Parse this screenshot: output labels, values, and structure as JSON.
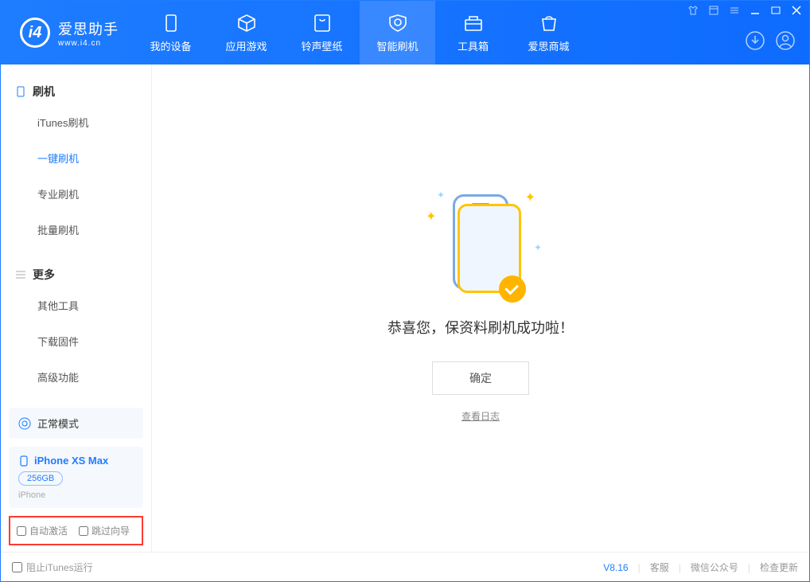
{
  "logo": {
    "main": "爱思助手",
    "sub": "www.i4.cn"
  },
  "nav": [
    {
      "label": "我的设备",
      "icon": "phone"
    },
    {
      "label": "应用游戏",
      "icon": "cube"
    },
    {
      "label": "铃声壁纸",
      "icon": "wallpaper"
    },
    {
      "label": "智能刷机",
      "icon": "shield",
      "active": true
    },
    {
      "label": "工具箱",
      "icon": "toolbox"
    },
    {
      "label": "爱思商城",
      "icon": "bag"
    }
  ],
  "sidebar": {
    "section1": {
      "title": "刷机",
      "items": [
        "iTunes刷机",
        "一键刷机",
        "专业刷机",
        "批量刷机"
      ],
      "activeIndex": 1
    },
    "section2": {
      "title": "更多",
      "items": [
        "其他工具",
        "下载固件",
        "高级功能"
      ]
    },
    "mode": "正常模式",
    "device": {
      "name": "iPhone XS Max",
      "capacity": "256GB",
      "type": "iPhone"
    },
    "options": {
      "autoActivate": "自动激活",
      "skipGuide": "跳过向导"
    }
  },
  "content": {
    "message": "恭喜您，保资料刷机成功啦！",
    "okBtn": "确定",
    "logLink": "查看日志"
  },
  "footer": {
    "blockItunes": "阻止iTunes运行",
    "version": "V8.16",
    "links": [
      "客服",
      "微信公众号",
      "检查更新"
    ]
  }
}
